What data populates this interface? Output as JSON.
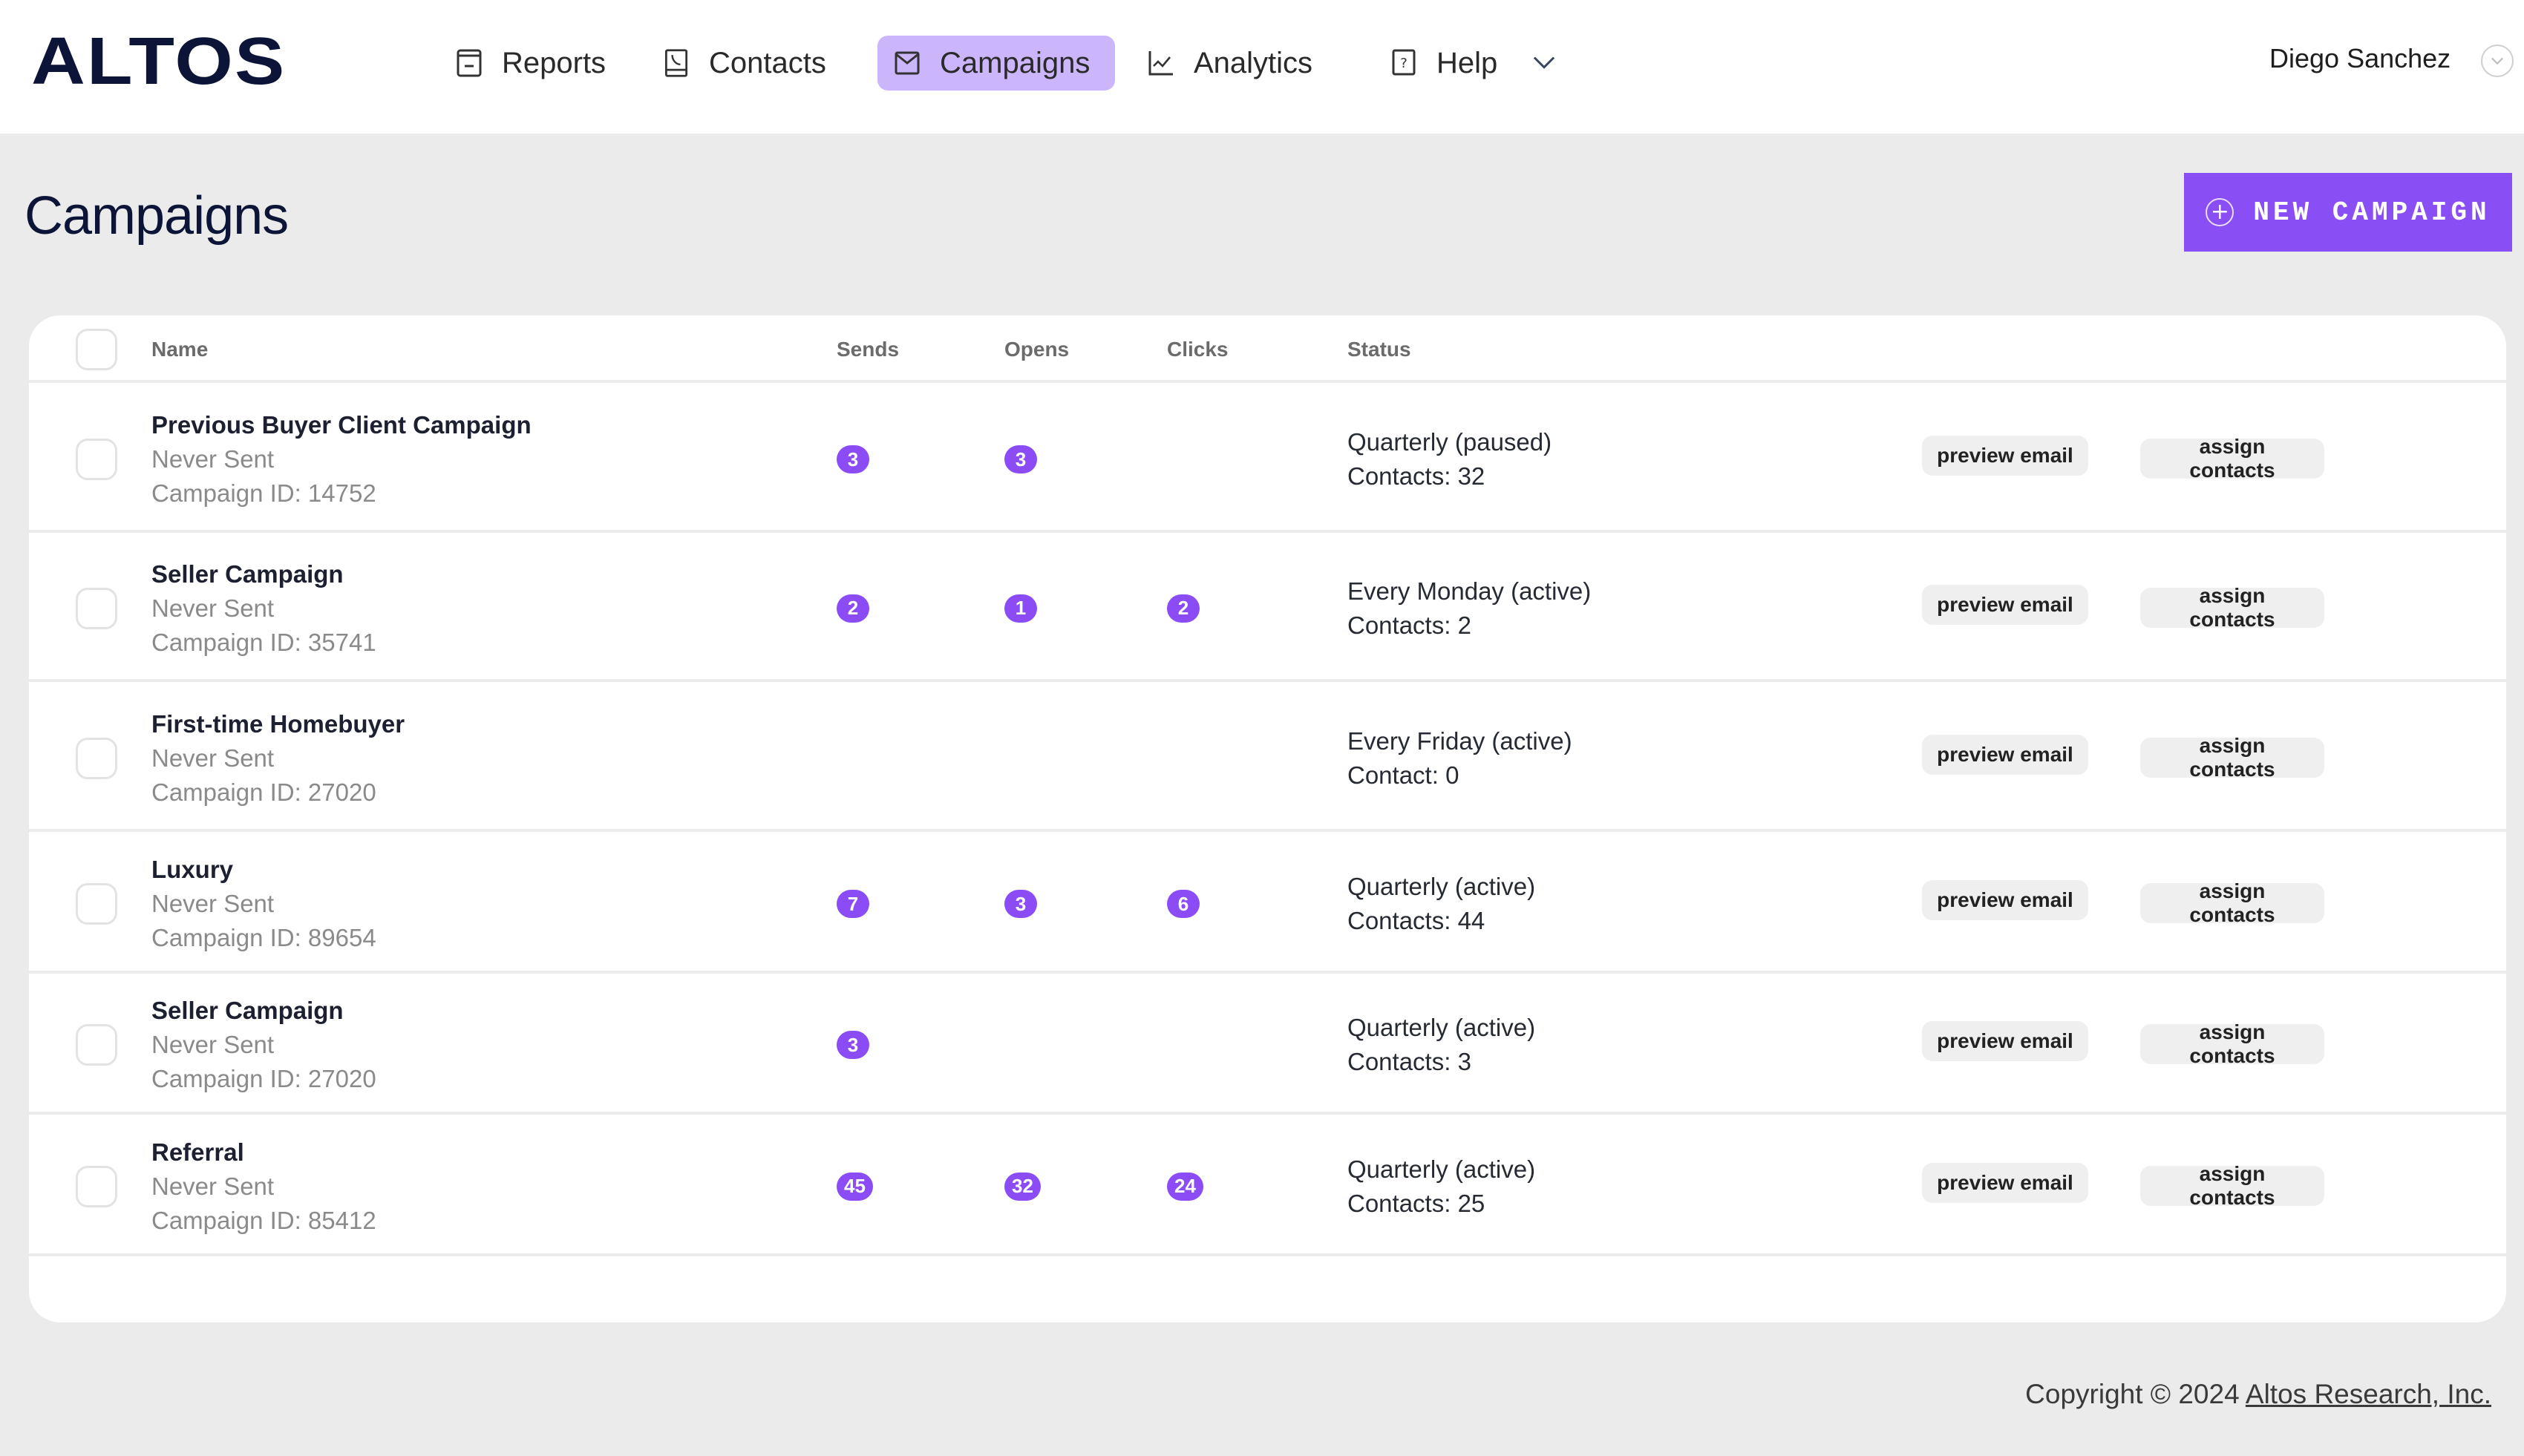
{
  "app": {
    "logo": "ALTOS",
    "user_name": "Diego Sanchez"
  },
  "nav": {
    "items": [
      {
        "label": "Reports",
        "icon": "report-icon",
        "active": false
      },
      {
        "label": "Contacts",
        "icon": "contact-book-icon",
        "active": false
      },
      {
        "label": "Campaigns",
        "icon": "envelope-icon",
        "active": true
      },
      {
        "label": "Analytics",
        "icon": "line-chart-icon",
        "active": false
      },
      {
        "label": "Help",
        "icon": "help-book-icon",
        "active": false,
        "has_dropdown": true
      }
    ]
  },
  "page": {
    "title": "Campaigns",
    "new_button_label": "NEW CAMPAIGN"
  },
  "table": {
    "columns": [
      "Name",
      "Sends",
      "Opens",
      "Clicks",
      "Status"
    ],
    "row_actions": {
      "preview": "preview email",
      "assign": "assign contacts"
    },
    "rows": [
      {
        "name": "Previous Buyer Client Campaign",
        "last_sent": "Never Sent",
        "campaign_id": "Campaign ID: 14752",
        "sends": "3",
        "opens": "3",
        "clicks": null,
        "schedule": "Quarterly (paused)",
        "contacts": "Contacts: 32"
      },
      {
        "name": "Seller Campaign",
        "last_sent": "Never Sent",
        "campaign_id": "Campaign ID: 35741",
        "sends": "2",
        "opens": "1",
        "clicks": "2",
        "schedule": "Every Monday (active)",
        "contacts": "Contacts: 2"
      },
      {
        "name": "First-time Homebuyer",
        "last_sent": "Never Sent",
        "campaign_id": "Campaign ID: 27020",
        "sends": null,
        "opens": null,
        "clicks": null,
        "schedule": "Every Friday (active)",
        "contacts": "Contact: 0"
      },
      {
        "name": "Luxury",
        "last_sent": "Never Sent",
        "campaign_id": "Campaign ID: 89654",
        "sends": "7",
        "opens": "3",
        "clicks": "6",
        "schedule": "Quarterly (active)",
        "contacts": "Contacts: 44"
      },
      {
        "name": "Seller Campaign",
        "last_sent": "Never Sent",
        "campaign_id": "Campaign ID: 27020",
        "sends": "3",
        "opens": null,
        "clicks": null,
        "schedule": "Quarterly (active)",
        "contacts": "Contacts: 3"
      },
      {
        "name": "Referral",
        "last_sent": "Never Sent",
        "campaign_id": "Campaign ID: 85412",
        "sends": "45",
        "opens": "32",
        "clicks": "24",
        "schedule": "Quarterly (active)",
        "contacts": "Contacts: 25"
      }
    ]
  },
  "footer": {
    "copyright": "Copyright © 2024 ",
    "company_link": "Altos Research, Inc."
  },
  "colors": {
    "accent": "#8a4ef5",
    "nav_active_bg": "#cbb6fb",
    "brand_navy": "#0c1538",
    "page_bg": "#ebebeb"
  }
}
